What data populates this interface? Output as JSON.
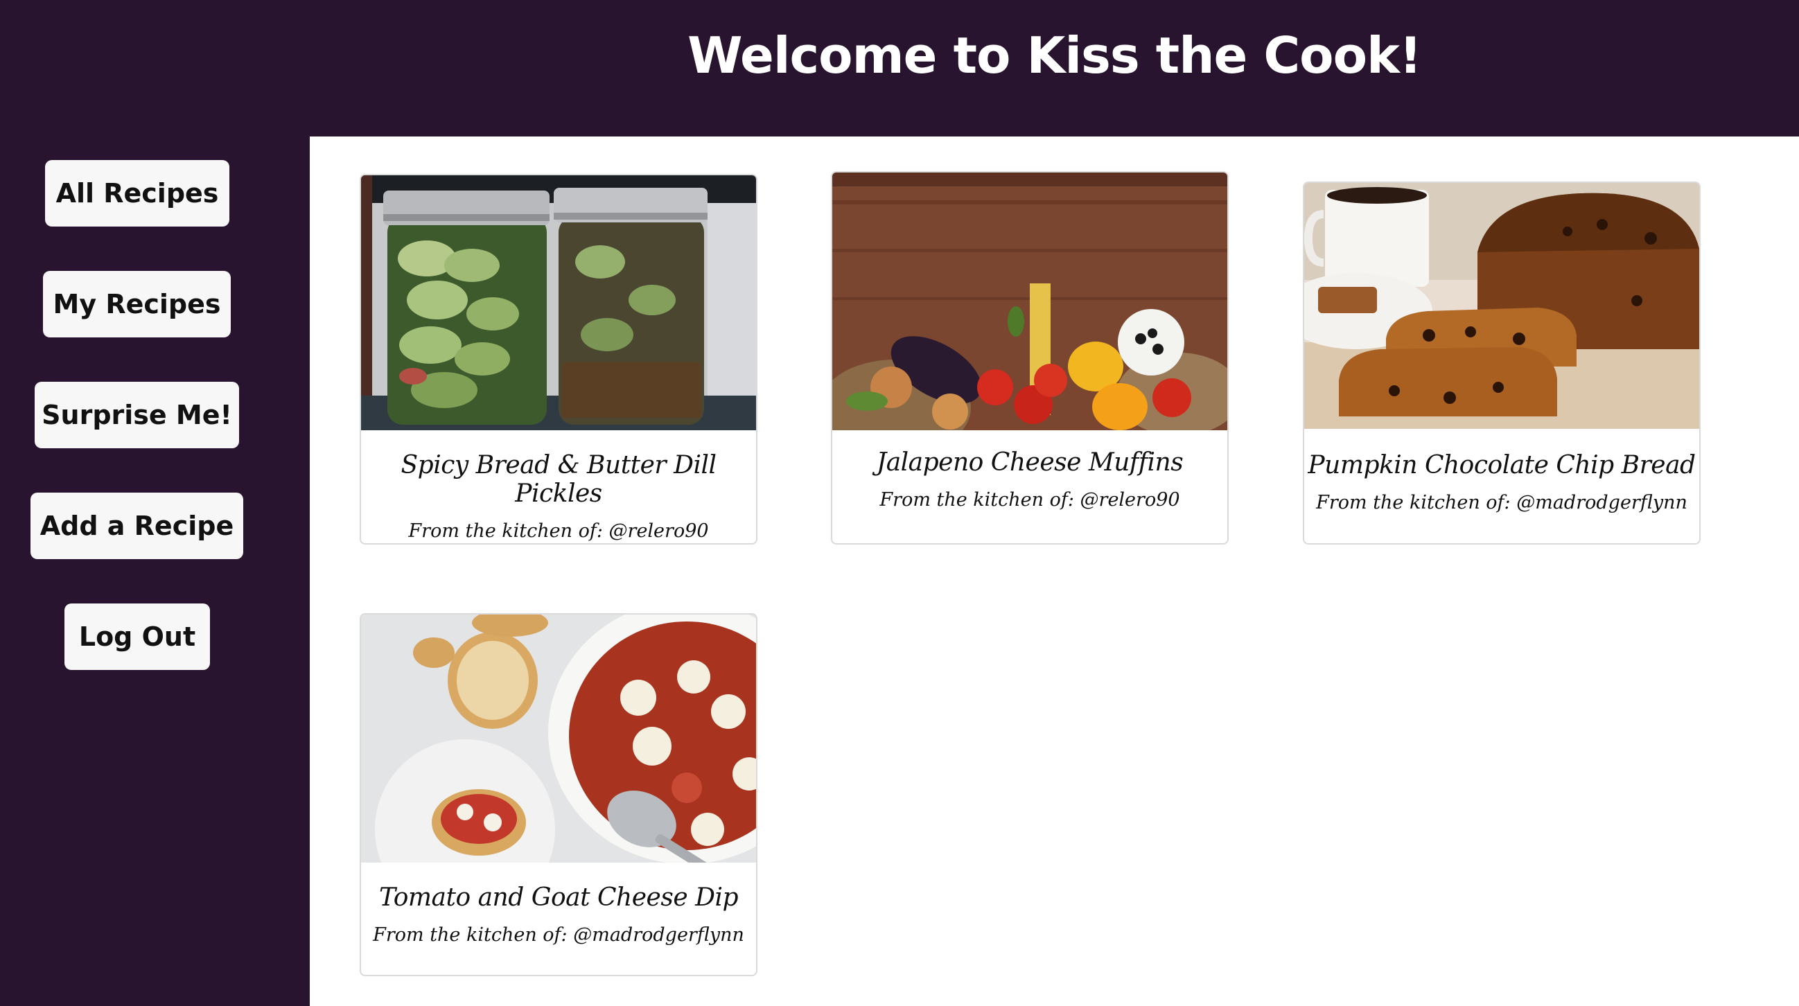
{
  "header": {
    "title": "Welcome to Kiss the Cook!"
  },
  "sidebar": {
    "buttons": [
      {
        "label": "All Recipes"
      },
      {
        "label": "My Recipes"
      },
      {
        "label": "Surprise Me!"
      },
      {
        "label": "Add a Recipe"
      },
      {
        "label": "Log Out"
      }
    ]
  },
  "recipes": [
    {
      "title": "Spicy Bread & Butter Dill Pickles",
      "byline": "From the kitchen of: @relero90"
    },
    {
      "title": "Jalapeno Cheese Muffins",
      "byline": "From the kitchen of: @relero90"
    },
    {
      "title": "Pumpkin Chocolate Chip Bread",
      "byline": "From the kitchen of: @madrodgerflynn"
    },
    {
      "title": "Tomato and Goat Cheese Dip",
      "byline": "From the kitchen of: @madrodgerflynn"
    }
  ],
  "colors": {
    "brand_dark": "#28142e",
    "button_bg": "#f7f7f8",
    "card_border": "#dadada"
  }
}
